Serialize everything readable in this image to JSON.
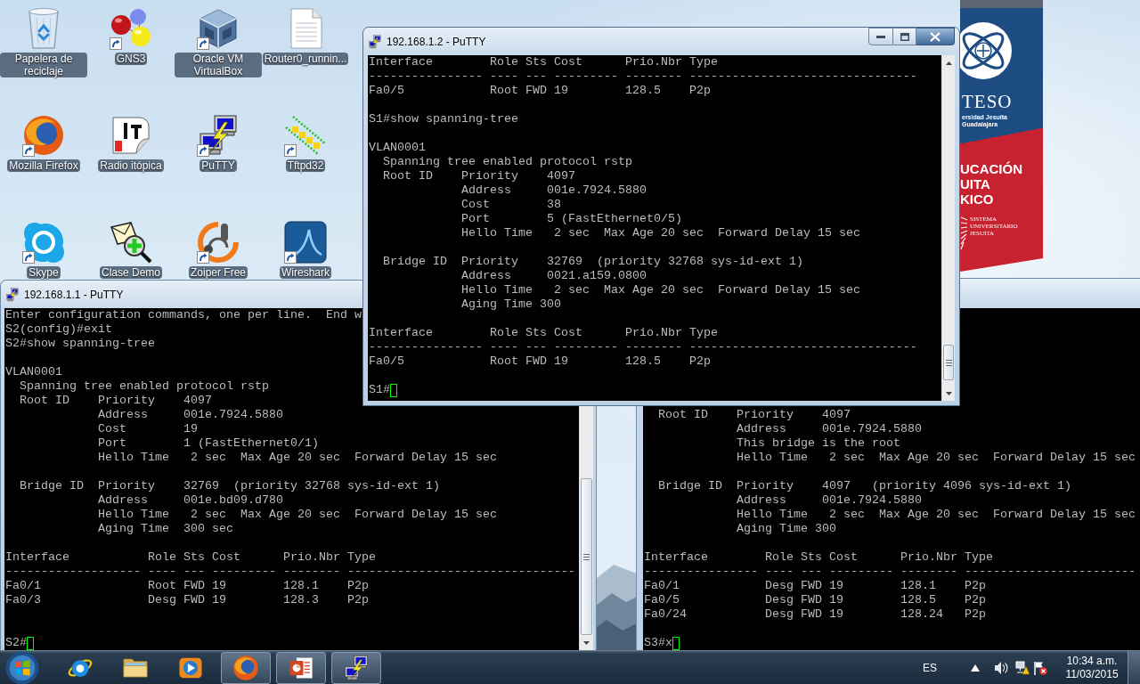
{
  "desktop_icons": [
    {
      "label": "Papelera de reciclaje",
      "kind": "recycle-bin",
      "shortcut": false
    },
    {
      "label": "GNS3",
      "kind": "spheres",
      "shortcut": true
    },
    {
      "label": "Oracle VM VirtualBox",
      "kind": "cube",
      "shortcut": true
    },
    {
      "label": "Router0_runnin...",
      "kind": "document",
      "shortcut": false
    },
    {
      "label": "Mozilla Firefox",
      "kind": "globe",
      "shortcut": true
    },
    {
      "label": "Radio itópica",
      "kind": "sticker",
      "shortcut": false
    },
    {
      "label": "PuTTY",
      "kind": "terminal",
      "shortcut": true
    },
    {
      "label": "Tftpd32",
      "kind": "tftp",
      "shortcut": true
    },
    {
      "label": "Skype",
      "kind": "cloud",
      "shortcut": true
    },
    {
      "label": "Clase Demo",
      "kind": "envelope",
      "shortcut": false
    },
    {
      "label": "Zoiper Free",
      "kind": "headset",
      "shortcut": true
    },
    {
      "label": "Wireshark",
      "kind": "fin",
      "shortcut": true
    }
  ],
  "wallpaper_banner": {
    "name": "TESO",
    "subtitle": [
      "ersidad Jesuita",
      "Guadalajara"
    ],
    "slogan": [
      "UCACIÓN",
      "UITA",
      "KICO"
    ],
    "system": [
      "SISTEMA",
      "UNIVERSITARIO",
      "JESUITA"
    ]
  },
  "windows": [
    {
      "title": "192.168.1.2 - PuTTY",
      "blocks": [
        [
          "Interface        Role Sts Cost      Prio.Nbr Type",
          "---------------- ---- --- --------- -------- --------------------------------",
          "Fa0/5            Root FWD 19        128.5    P2p"
        ],
        [
          "S1#show spanning-tree"
        ],
        [
          "VLAN0001",
          "  Spanning tree enabled protocol rstp",
          "  Root ID    Priority    4097",
          "             Address     001e.7924.5880",
          "             Cost        38",
          "             Port        5 (FastEthernet0/5)",
          "             Hello Time   2 sec  Max Age 20 sec  Forward Delay 15 sec"
        ],
        [
          "  Bridge ID  Priority    32769  (priority 32768 sys-id-ext 1)",
          "             Address     0021.a159.0800",
          "             Hello Time   2 sec  Max Age 20 sec  Forward Delay 15 sec",
          "             Aging Time 300"
        ],
        [
          "Interface        Role Sts Cost      Prio.Nbr Type",
          "---------------- ---- --- --------- -------- --------------------------------",
          "Fa0/5            Root FWD 19        128.5    P2p"
        ]
      ],
      "prompt": "S1#"
    },
    {
      "title": "192.168.1.1 - PuTTY",
      "blocks": [
        [
          "Enter configuration commands, one per line.  End w",
          "S2(config)#exit",
          "S2#show spanning-tree"
        ],
        [
          "VLAN0001",
          "  Spanning tree enabled protocol rstp",
          "  Root ID    Priority    4097",
          "             Address     001e.7924.5880",
          "             Cost        19",
          "             Port        1 (FastEthernet0/1)",
          "             Hello Time   2 sec  Max Age 20 sec  Forward Delay 15 sec"
        ],
        [
          "  Bridge ID  Priority    32769  (priority 32768 sys-id-ext 1)",
          "             Address     001e.bd09.d780",
          "             Hello Time   2 sec  Max Age 20 sec  Forward Delay 15 sec",
          "             Aging Time  300 sec"
        ],
        [
          "Interface           Role Sts Cost      Prio.Nbr Type",
          "------------------- ---- --- --------- -------- --------------------------------",
          "Fa0/1               Root FWD 19        128.1    P2p",
          "Fa0/3               Desg FWD 19        128.3    P2p"
        ]
      ],
      "prompt": "S2#"
    },
    {
      "blocks": [
        [
          "  Root ID    Priority    4097",
          "             Address     001e.7924.5880",
          "             This bridge is the root",
          "             Hello Time   2 sec  Max Age 20 sec  Forward Delay 15 sec"
        ],
        [
          "  Bridge ID  Priority    4097   (priority 4096 sys-id-ext 1)",
          "             Address     001e.7924.5880",
          "             Hello Time   2 sec  Max Age 20 sec  Forward Delay 15 sec",
          "             Aging Time 300"
        ],
        [
          "Interface        Role Sts Cost      Prio.Nbr Type",
          "---------------- ---- --- --------- -------- ------------------------",
          "Fa0/1            Desg FWD 19        128.1    P2p",
          "Fa0/5            Desg FWD 19        128.5    P2p",
          "Fa0/24           Desg FWD 19        128.24   P2p"
        ]
      ],
      "prompt": "S3#x"
    }
  ],
  "taskbar": {
    "apps": [
      {
        "kind": "browser",
        "running": false
      },
      {
        "kind": "folder",
        "running": false
      },
      {
        "kind": "media",
        "running": false
      },
      {
        "kind": "globe",
        "running": true
      },
      {
        "kind": "slides",
        "running": true
      },
      {
        "kind": "terminal",
        "running": true
      }
    ],
    "language": "ES",
    "time": "10:34 a.m.",
    "date": "11/03/2015"
  }
}
